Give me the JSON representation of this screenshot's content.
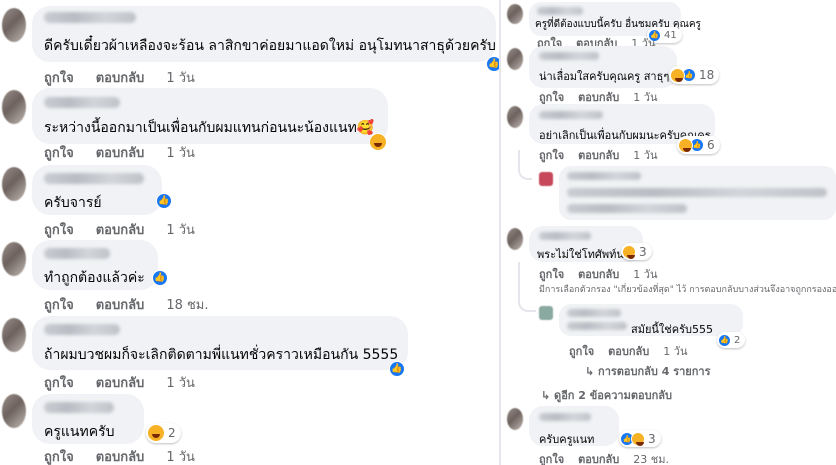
{
  "actions": {
    "like": "ถูกใจ",
    "reply": "ตอบกลับ"
  },
  "left": {
    "comments": [
      {
        "text": "ดีครับเดี๋ยวผ้าเหลืองจะร้อน ลาสิกขาค่อยมาแอดใหม่ อนุโมทนาสาธุด้วยครับ",
        "time": "1 วัน",
        "reactions": ""
      },
      {
        "text": "ระหว่างนี้ออกมาเป็นเพื่อนกับผมแทนก่อนนะน้องแนท🥰",
        "time": "1 วัน",
        "reactions": ""
      },
      {
        "text": "ครับจารย์",
        "time": "1 วัน",
        "reactions": ""
      },
      {
        "text": "ทำถูกต้องแล้วค่ะ",
        "time": "18 ชม.",
        "reactions": ""
      },
      {
        "text": "ถ้าผมบวชผมก็จะเลิกติดตามพี่แนทชั่วคราวเหมือนกัน 5555",
        "time": "1 วัน",
        "reactions": ""
      },
      {
        "text": "ครูแนทครับ",
        "time": "1 วัน",
        "reactions": "2"
      }
    ]
  },
  "right": {
    "comments": [
      {
        "text": "ครูที่ดีต้องแบบนี้ครับ อื่นชมครับ คุณครู",
        "time": "1 วัน",
        "reactions": "41"
      },
      {
        "text": "น่าเลื่อมใสครับคุณครู สาธุๆ",
        "time": "1 วัน",
        "reactions": "18"
      },
      {
        "text": "อย่าเลิกเป็นเพื่อนกับผมนะครับคุณครู",
        "time": "1 วัน",
        "reactions": "6"
      },
      {
        "text": "พระไม่ใช่โทศัพท์นะ",
        "time": "1 วัน",
        "reactions": "3"
      },
      {
        "text": "สมัยนี้ใช่ครับ555",
        "time": "1 วัน",
        "reactions": "2"
      },
      {
        "text": "ครับครูแนท",
        "time": "23 ชม.",
        "reactions": "3"
      }
    ],
    "filter_note": "มีการเลือกตัวกรอง \"เกี่ยวข้องที่สุด\" ไว้ การตอบกลับบางส่วนจึงอาจถูกกรองออก",
    "replies_link": "↳ การตอบกลับ 4 รายการ",
    "view_replies": "↳ ดูอีก 2 ข้อความตอบกลับ"
  },
  "colors": {
    "bubble": "#f0f2f5",
    "meta": "#65676b",
    "like_blue": "#1877f2",
    "haha": "#f7b125"
  },
  "icons": [
    "like-icon",
    "haha-icon",
    "care-icon"
  ]
}
